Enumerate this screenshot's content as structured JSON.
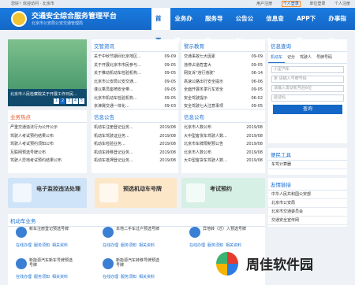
{
  "topbar": {
    "left": "您好！欢迎访问 · 北京市",
    "links": [
      "用户注册",
      "个人登录",
      "单位登录",
      "个人注册"
    ],
    "highlighted": "个人登录"
  },
  "header": {
    "title": "交通安全综合服务管理平台",
    "subtitle": "北京市公安局公安交通管理局"
  },
  "nav": [
    "首页",
    "业务办理",
    "服务导航",
    "公告公布",
    "信息查询",
    "APP下载",
    "办事指南"
  ],
  "banner": {
    "caption": "北京市人民检察院关于开展工作日民...",
    "pages": [
      "1",
      "2",
      "3",
      "4",
      "5"
    ],
    "active": "2"
  },
  "news": {
    "title": "交管资讯",
    "items": [
      {
        "t": "关于中秋节期间北京地区...",
        "d": "09-09"
      },
      {
        "t": "关于开展北京市市民参与...",
        "d": "09-05"
      },
      {
        "t": "关于推动机动车检验机构...",
        "d": "09-05"
      },
      {
        "t": "北京市公安局公安交通...",
        "d": "09-05"
      },
      {
        "t": "谨以乘员座椅安全带...",
        "d": "09-05"
      },
      {
        "t": "北京市机动车检验机构...",
        "d": "09-05"
      },
      {
        "t": "京津冀交通一体化...",
        "d": "09-03"
      },
      {
        "t": "切实关注校园交通安全...",
        "d": "09-03"
      }
    ]
  },
  "warning": {
    "title": "警示教育",
    "items": [
      {
        "t": "交通事故七大因素",
        "d": "09-09"
      },
      {
        "t": "违停占道危害大",
        "d": "09-05"
      },
      {
        "t": "网友诉\"违行违驶\"",
        "d": "06-14"
      },
      {
        "t": "高速公路出行安全提示",
        "d": "06-06"
      },
      {
        "t": "全面开展冬季行车安全",
        "d": "09-05"
      },
      {
        "t": "安全驾驶提示",
        "d": "06-02"
      },
      {
        "t": "安全驾驶七大注意事项",
        "d": "09-05"
      }
    ]
  },
  "hot": {
    "title": "业务热点",
    "items": [
      {
        "t": "严重交通违法行为公开公示"
      },
      {
        "t": "驾驶人考试预约结果公布"
      },
      {
        "t": "驾驶人考试预约须知公布"
      },
      {
        "t": "互联网预选号牌公布"
      },
      {
        "t": "驾驶人异地考试预约结果公布"
      }
    ]
  },
  "notice": {
    "title": "信息公告",
    "items": [
      {
        "t": "机动车注册登记业务...",
        "d": "2019/08"
      },
      {
        "t": "机动车驾驶证业务...",
        "d": "2019/08"
      },
      {
        "t": "机动车检验业务...",
        "d": "2019/08"
      },
      {
        "t": "机动车转移登记业务...",
        "d": "2019/08"
      },
      {
        "t": "机动车抵押登记业务...",
        "d": "2019/08"
      }
    ]
  },
  "announce": {
    "title": "信息公布",
    "items": [
      {
        "t": "北京市人数公布",
        "d": "2019/08"
      },
      {
        "t": "大中型客货车驾驶人数...",
        "d": "2019/08"
      },
      {
        "t": "北京市车牌限制预公告",
        "d": "2019/08"
      },
      {
        "t": "北京市人数公布",
        "d": "2019/08"
      },
      {
        "t": "大中型客货车驾驶人数...",
        "d": "2019/08"
      }
    ]
  },
  "services": [
    {
      "label": "电子监控违法处理",
      "color": "#cfe4f8"
    },
    {
      "label": "预选机动车号牌",
      "color": "#fde7c9"
    },
    {
      "label": "考试预约",
      "color": "#d6f0e6"
    }
  ],
  "motor": {
    "title": "机动车业务",
    "items": [
      {
        "t": "新车注册登记预选号牌",
        "a": [
          "在线办理",
          "服务须知",
          "相关资料"
        ]
      },
      {
        "t": "本地二手车过户预选号牌",
        "a": [
          "在线办理",
          "服务须知",
          "相关资料"
        ]
      },
      {
        "t": "异地转（迁）入预选号牌",
        "a": [
          "在线办理",
          "服务须知",
          "相关资料"
        ]
      },
      {
        "t": "新能源汽车新车号牌预选号牌",
        "a": [
          "在线办理",
          "服务须知",
          "相关资料"
        ]
      },
      {
        "t": "新能源汽车转移号牌预选号牌",
        "a": [
          "在线办理",
          "服务须知",
          "相关资料"
        ]
      }
    ]
  },
  "query": {
    "title": "信息查询",
    "tabs": [
      "机动车",
      "记分",
      "驾驶人",
      "号牌号码"
    ],
    "active": "机动车",
    "fields": [
      "小型汽车",
      "京 请输入号牌号码",
      "请输入发动机号后6位",
      "验证码"
    ],
    "button": "查询"
  },
  "tools": {
    "title": "便民工具",
    "items": [
      "车驾计算器"
    ]
  },
  "links": {
    "title": "友情链接",
    "items": [
      "中华人民共和国公安部",
      "北京市公安局",
      "北京市交通委员会",
      "交通安全宣传网"
    ]
  },
  "watermark": {
    "text": "周佳软件园"
  }
}
